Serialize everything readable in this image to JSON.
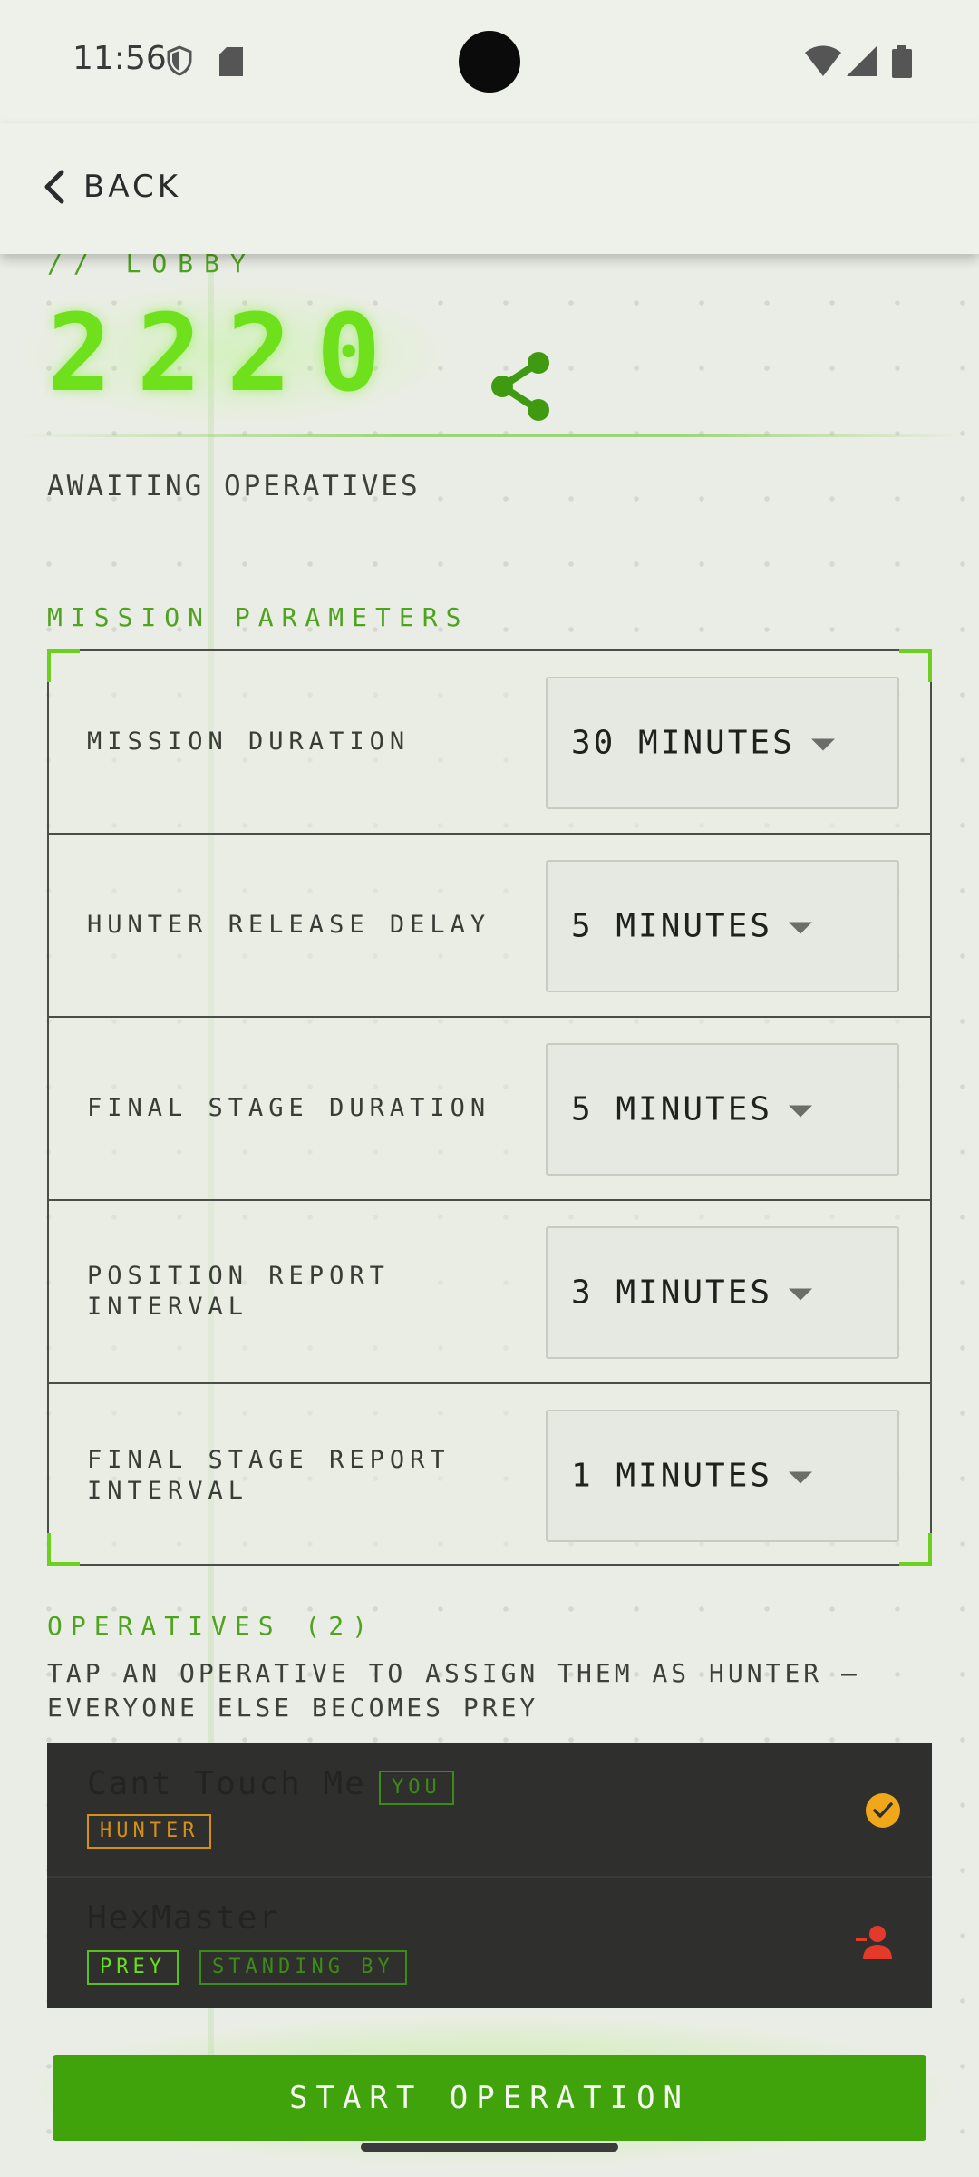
{
  "status_bar": {
    "time": "11:56"
  },
  "app_bar": {
    "back_label": "BACK"
  },
  "lobby": {
    "label": "// LOBBY",
    "code": "2220",
    "status": "AWAITING OPERATIVES"
  },
  "mission": {
    "title": "MISSION PARAMETERS",
    "params": [
      {
        "label": "MISSION DURATION",
        "value": "30 MINUTES"
      },
      {
        "label": "HUNTER RELEASE DELAY",
        "value": "5 MINUTES"
      },
      {
        "label": "FINAL STAGE DURATION",
        "value": "5 MINUTES"
      },
      {
        "label": "POSITION REPORT INTERVAL",
        "value": "3 MINUTES"
      },
      {
        "label": "FINAL STAGE REPORT INTERVAL",
        "value": "1 MINUTES"
      }
    ]
  },
  "operatives": {
    "title": "OPERATIVES (2)",
    "instruction": "TAP AN OPERATIVE TO ASSIGN THEM AS HUNTER — EVERYONE ELSE BECOMES PREY",
    "list": [
      {
        "name": "Cant Touch Me",
        "you_tag": "YOU",
        "role": "HUNTER",
        "status_icon": "check-circle-icon"
      },
      {
        "name": "HexMaster",
        "role": "PREY",
        "status": "STANDING BY",
        "status_icon": "assign-person-icon"
      }
    ]
  },
  "start_button": {
    "label": "START OPERATION"
  },
  "colors": {
    "accent_green": "#41a30b",
    "code_green": "#6fe01c",
    "hunter_orange": "#d48f15",
    "assign_red": "#e53a2a",
    "background": "#eaede5"
  }
}
